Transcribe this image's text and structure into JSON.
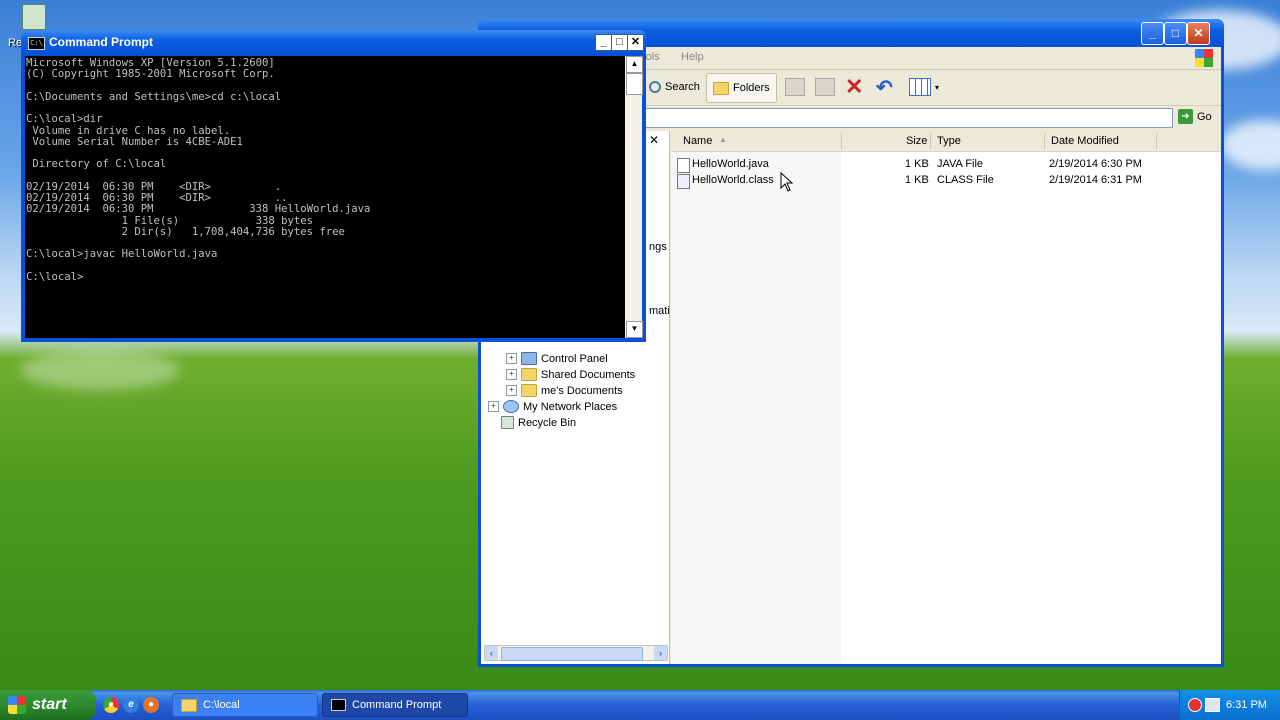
{
  "desktop": {
    "recycle_label": "Re"
  },
  "explorer": {
    "menu": [
      "Tools",
      "Help"
    ],
    "toolbar": {
      "search": "Search",
      "folders": "Folders"
    },
    "address": {
      "value": "",
      "go": "Go"
    },
    "tree": [
      {
        "label": "Control Panel",
        "icon": "control-panel-icon",
        "expand": true
      },
      {
        "label": "Shared Documents",
        "icon": "folder-icon",
        "expand": true
      },
      {
        "label": "me's Documents",
        "icon": "folder-icon",
        "expand": true
      },
      {
        "label": "My Network Places",
        "icon": "network-icon",
        "expand": true
      },
      {
        "label": "Recycle Bin",
        "icon": "recycle-bin-icon",
        "expand": false
      }
    ],
    "tree_cut": [
      "ngs",
      "mati"
    ],
    "columns": {
      "name": "Name",
      "size": "Size",
      "type": "Type",
      "date": "Date Modified"
    },
    "files": [
      {
        "name": "HelloWorld.java",
        "size": "1 KB",
        "type": "JAVA File",
        "date": "2/19/2014 6:30 PM"
      },
      {
        "name": "HelloWorld.class",
        "size": "1 KB",
        "type": "CLASS File",
        "date": "2/19/2014 6:31 PM"
      }
    ]
  },
  "cmd": {
    "title": "Command Prompt",
    "output": "Microsoft Windows XP [Version 5.1.2600]\n(C) Copyright 1985-2001 Microsoft Corp.\n\nC:\\Documents and Settings\\me>cd c:\\local\n\nC:\\local>dir\n Volume in drive C has no label.\n Volume Serial Number is 4CBE-ADE1\n\n Directory of C:\\local\n\n02/19/2014  06:30 PM    <DIR>          .\n02/19/2014  06:30 PM    <DIR>          ..\n02/19/2014  06:30 PM               338 HelloWorld.java\n               1 File(s)            338 bytes\n               2 Dir(s)   1,708,404,736 bytes free\n\nC:\\local>javac HelloWorld.java\n\nC:\\local>"
  },
  "taskbar": {
    "start": "start",
    "tasks": [
      {
        "label": "C:\\local",
        "active": false
      },
      {
        "label": "Command Prompt",
        "active": true
      }
    ],
    "clock": "6:31 PM"
  }
}
